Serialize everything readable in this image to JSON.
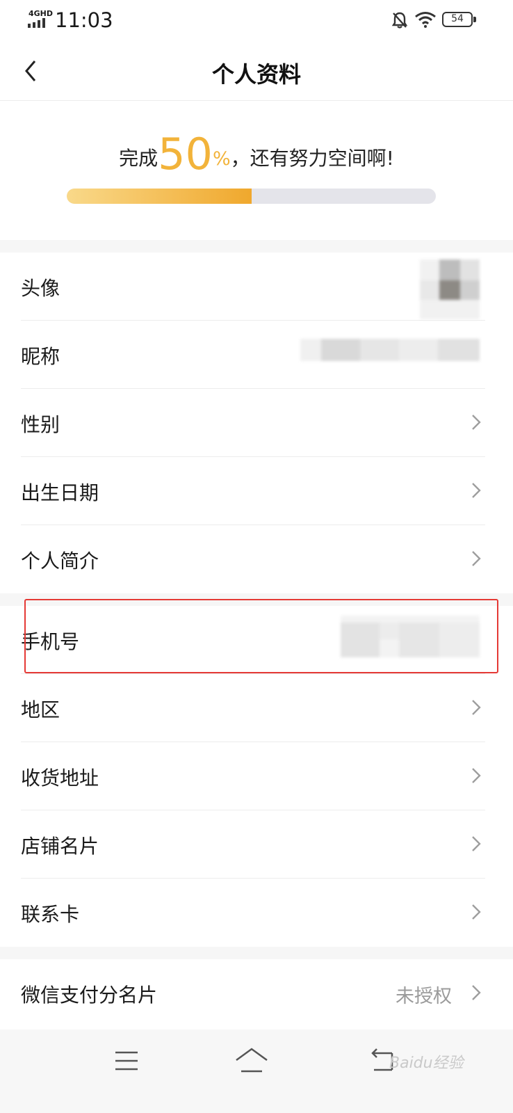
{
  "status_bar": {
    "network": "4GHD",
    "time": "11:03",
    "battery": "54"
  },
  "nav": {
    "title": "个人资料"
  },
  "progress": {
    "prefix": "完成",
    "percent": "50",
    "unit": "%",
    "suffix": "，还有努力空间啊!",
    "fraction": 0.5
  },
  "rows": [
    {
      "label": "头像"
    },
    {
      "label": "昵称"
    },
    {
      "label": "性别"
    },
    {
      "label": "出生日期"
    },
    {
      "label": "个人简介"
    },
    {
      "label": "手机号"
    },
    {
      "label": "地区"
    },
    {
      "label": "收货地址"
    },
    {
      "label": "店铺名片"
    },
    {
      "label": "联系卡"
    }
  ],
  "wechat_pay_row": {
    "label": "微信支付分名片",
    "value": "未授权"
  },
  "watermark": "Baidu经验",
  "colors": {
    "accent": "#f2b33a",
    "highlight": "#e53935"
  }
}
